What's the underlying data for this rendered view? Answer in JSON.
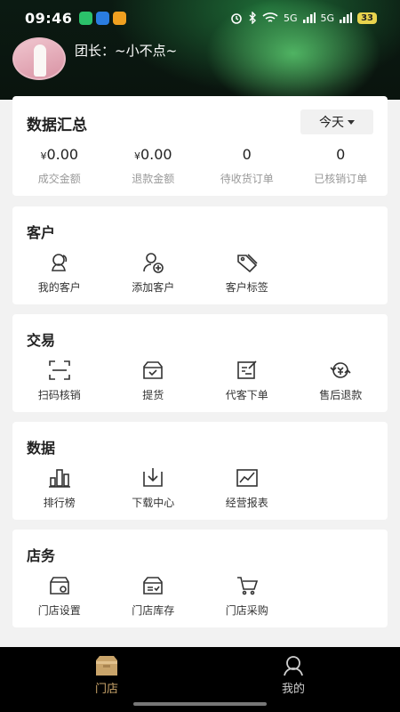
{
  "status_bar": {
    "time": "09:46",
    "app_icons": [
      "wechat-icon",
      "location-app-icon",
      "wallet-app-icon"
    ],
    "signal_text": "5G",
    "battery": "33"
  },
  "header": {
    "leader_label": "团长：~小不点~"
  },
  "summary": {
    "title": "数据汇总",
    "date_filter": "今天",
    "stats": [
      {
        "currency": "¥",
        "value": "0.00",
        "label": "成交金额"
      },
      {
        "currency": "¥",
        "value": "0.00",
        "label": "退款金额"
      },
      {
        "currency": "",
        "value": "0",
        "label": "待收货订单"
      },
      {
        "currency": "",
        "value": "0",
        "label": "已核销订单"
      }
    ]
  },
  "sections": {
    "customers": {
      "title": "客户",
      "items": [
        {
          "label": "我的客户",
          "icon": "my-customers-icon"
        },
        {
          "label": "添加客户",
          "icon": "add-customer-icon"
        },
        {
          "label": "客户标签",
          "icon": "customer-tag-icon"
        }
      ]
    },
    "trade": {
      "title": "交易",
      "items": [
        {
          "label": "扫码核销",
          "icon": "scan-icon"
        },
        {
          "label": "提货",
          "icon": "pickup-icon"
        },
        {
          "label": "代客下单",
          "icon": "proxy-order-icon"
        },
        {
          "label": "售后退款",
          "icon": "refund-icon"
        }
      ]
    },
    "data": {
      "title": "数据",
      "items": [
        {
          "label": "排行榜",
          "icon": "ranking-icon"
        },
        {
          "label": "下载中心",
          "icon": "download-icon"
        },
        {
          "label": "经营报表",
          "icon": "report-icon"
        }
      ]
    },
    "store": {
      "title": "店务",
      "items": [
        {
          "label": "门店设置",
          "icon": "store-settings-icon"
        },
        {
          "label": "门店库存",
          "icon": "store-inventory-icon"
        },
        {
          "label": "门店采购",
          "icon": "store-purchase-icon"
        }
      ]
    }
  },
  "tabbar": {
    "tabs": [
      {
        "label": "门店",
        "icon": "store-icon",
        "active": true
      },
      {
        "label": "我的",
        "icon": "profile-icon",
        "active": false
      }
    ]
  },
  "colors": {
    "accent_tab": "#c9a46a",
    "inactive_tab": "#cfcfcf",
    "card_bg": "#ffffff",
    "page_bg": "#f2f2f2"
  }
}
